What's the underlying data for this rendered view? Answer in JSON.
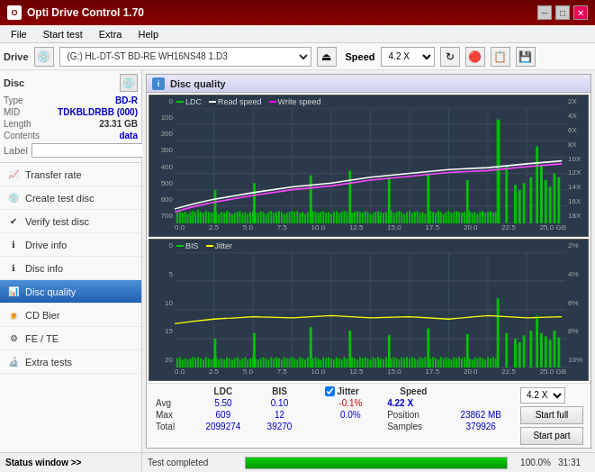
{
  "app": {
    "title": "Opti Drive Control 1.70",
    "titlebar_controls": [
      "minimize",
      "maximize",
      "close"
    ]
  },
  "menu": {
    "items": [
      "File",
      "Start test",
      "Extra",
      "Help"
    ]
  },
  "toolbar": {
    "drive_label": "Drive",
    "drive_value": "(G:)  HL-DT-ST BD-RE  WH16NS48 1.D3",
    "speed_label": "Speed",
    "speed_value": "4.2 X"
  },
  "disc_panel": {
    "title": "Disc",
    "type_label": "Type",
    "type_value": "BD-R",
    "mid_label": "MID",
    "mid_value": "TDKBLDRBB (000)",
    "length_label": "Length",
    "length_value": "23.31 GB",
    "contents_label": "Contents",
    "contents_value": "data",
    "label_label": "Label",
    "label_value": ""
  },
  "sidebar": {
    "items": [
      {
        "id": "transfer-rate",
        "label": "Transfer rate",
        "active": false
      },
      {
        "id": "create-test-disc",
        "label": "Create test disc",
        "active": false
      },
      {
        "id": "verify-test-disc",
        "label": "Verify test disc",
        "active": false
      },
      {
        "id": "drive-info",
        "label": "Drive info",
        "active": false
      },
      {
        "id": "disc-info",
        "label": "Disc info",
        "active": false
      },
      {
        "id": "disc-quality",
        "label": "Disc quality",
        "active": true
      },
      {
        "id": "cd-bier",
        "label": "CD Bier",
        "active": false
      },
      {
        "id": "fe-te",
        "label": "FE / TE",
        "active": false
      },
      {
        "id": "extra-tests",
        "label": "Extra tests",
        "active": false
      }
    ],
    "status_label": "Status window >>"
  },
  "disc_quality": {
    "title": "Disc quality",
    "chart1": {
      "legend": [
        {
          "label": "LDC",
          "color": "#00cc00"
        },
        {
          "label": "Read speed",
          "color": "#ffffff"
        },
        {
          "label": "Write speed",
          "color": "#ff00ff"
        }
      ],
      "y_labels": [
        "0",
        "100",
        "200",
        "300",
        "400",
        "500",
        "600",
        "700"
      ],
      "y_right_labels": [
        "2X",
        "4X",
        "6X",
        "8X",
        "10X",
        "12X",
        "14X",
        "16X",
        "18X"
      ],
      "x_labels": [
        "0.0",
        "2.5",
        "5.0",
        "7.5",
        "10.0",
        "12.5",
        "15.0",
        "17.5",
        "20.0",
        "22.5",
        "25.0 GB"
      ]
    },
    "chart2": {
      "legend": [
        {
          "label": "BIS",
          "color": "#00cc00"
        },
        {
          "label": "Jitter",
          "color": "#ffff00"
        }
      ],
      "y_labels": [
        "0",
        "5",
        "10",
        "15",
        "20"
      ],
      "y_right_labels": [
        "2%",
        "4%",
        "6%",
        "8%",
        "10%"
      ],
      "x_labels": [
        "0.0",
        "2.5",
        "5.0",
        "7.5",
        "10.0",
        "12.5",
        "15.0",
        "17.5",
        "20.0",
        "22.5",
        "25.0 GB"
      ]
    },
    "stats": {
      "headers": [
        "",
        "LDC",
        "BIS",
        "",
        "Jitter",
        "Speed",
        ""
      ],
      "avg_label": "Avg",
      "avg_ldc": "5.50",
      "avg_bis": "0.10",
      "avg_jitter": "-0.1%",
      "max_label": "Max",
      "max_ldc": "609",
      "max_bis": "12",
      "max_jitter": "0.0%",
      "total_label": "Total",
      "total_ldc": "2099274",
      "total_bis": "39270",
      "speed_value": "4.22 X",
      "speed_dropdown": "4.2 X",
      "position_label": "Position",
      "position_value": "23862 MB",
      "samples_label": "Samples",
      "samples_value": "379926"
    },
    "buttons": {
      "start_full": "Start full",
      "start_part": "Start part"
    },
    "jitter_checked": true,
    "jitter_label": "Jitter"
  },
  "status_bar": {
    "text": "Test completed",
    "progress": 100,
    "progress_text": "100.0%",
    "time": "31:31"
  }
}
